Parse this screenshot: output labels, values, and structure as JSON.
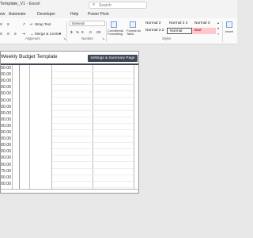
{
  "window": {
    "title": "Template_V1 - Excel",
    "search_placeholder": "Search"
  },
  "menu": {
    "tabs": [
      "ew",
      "Automate",
      "Developer",
      "Help",
      "Power Pivot"
    ]
  },
  "ribbon": {
    "wrap_text": "Wrap Text",
    "merge_center": "Merge & Center",
    "number_format": "General",
    "conditional_formatting": "Conditional Formatting",
    "format_as_table": "Format as Table",
    "alignment_label": "Alignment",
    "number_label": "Number",
    "styles_label": "Styles",
    "insert_label": "Insert",
    "styles": {
      "normal_2": "Normal 2",
      "normal_2_2": "Normal 2 2",
      "normal_3": "Normal 3",
      "normal_3_2": "Normal 3 2",
      "normal": "Normal",
      "bad": "Bad"
    },
    "colors": {
      "bad_bg": "#ffc7ce",
      "bad_text": "#9c0006"
    }
  },
  "sheet": {
    "title": "Weekly Budget Template",
    "button": "Settings & Summary Page",
    "values": [
      "00.00",
      "00.00",
      "00.00",
      "00.00",
      "00.00",
      "00.00",
      "00.00",
      "00.00",
      "00.00",
      "00.00",
      "00.00",
      "00.00",
      "00.00",
      "00.00",
      "00.00",
      "00.00",
      "75.00",
      "00.00",
      "00.00"
    ]
  }
}
